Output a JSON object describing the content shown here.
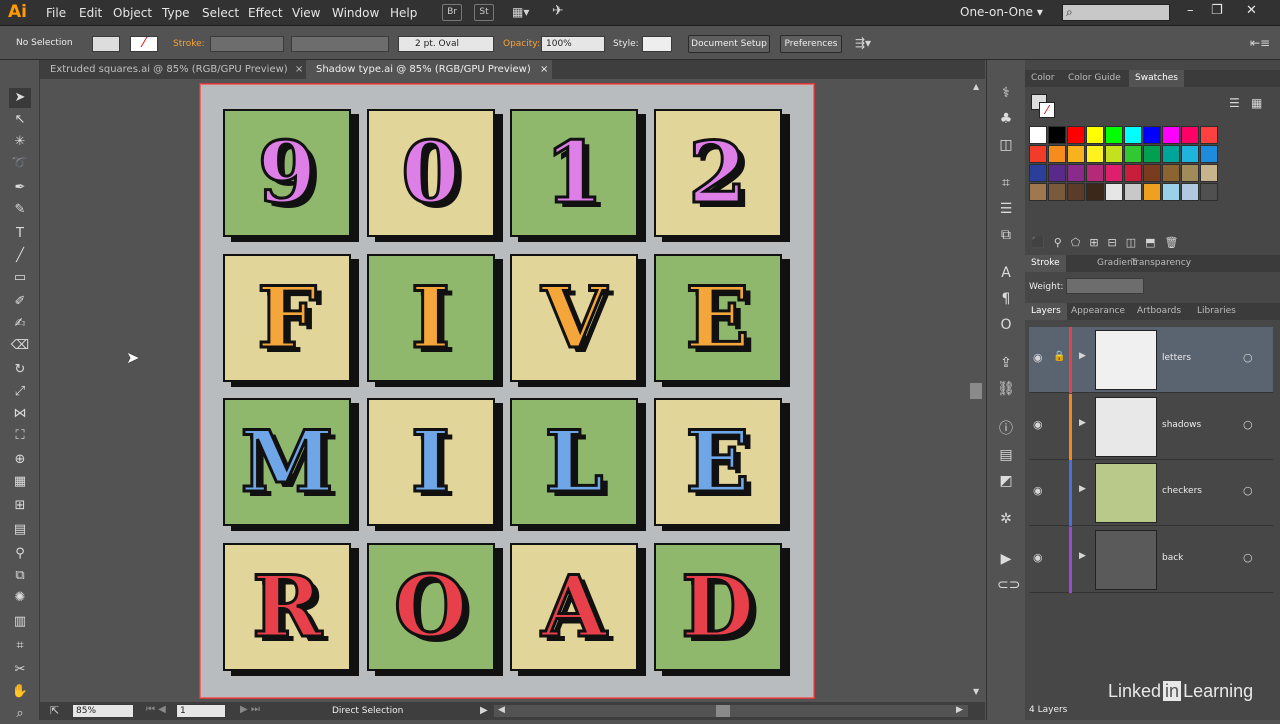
{
  "app": {
    "logo": "Ai"
  },
  "menu": [
    "File",
    "Edit",
    "Object",
    "Type",
    "Select",
    "Effect",
    "View",
    "Window",
    "Help"
  ],
  "menubar_buttons": {
    "br": "Br",
    "st": "St"
  },
  "workspace": {
    "label": "One-on-One",
    "arrow": "▾"
  },
  "control": {
    "selection": "No Selection",
    "stroke_label": "Stroke:",
    "brush": "2 pt. Oval",
    "opacity_label": "Opacity:",
    "opacity_value": "100%",
    "style_label": "Style:",
    "doc_setup": "Document Setup",
    "preferences": "Preferences"
  },
  "tabs": [
    {
      "label": "Extruded squares.ai @ 85% (RGB/GPU Preview)",
      "close": "×"
    },
    {
      "label": "Shadow type.ai @ 85% (RGB/GPU Preview)",
      "close": "×"
    }
  ],
  "tiles": [
    {
      "ch": "9",
      "bg": "#8fb86d",
      "fill": "#de7fe8"
    },
    {
      "ch": "0",
      "bg": "#e2d59a",
      "fill": "#de7fe8"
    },
    {
      "ch": "1",
      "bg": "#8fb86d",
      "fill": "#de7fe8"
    },
    {
      "ch": "2",
      "bg": "#e2d59a",
      "fill": "#de7fe8"
    },
    {
      "ch": "F",
      "bg": "#e2d59a",
      "fill": "#f4a63a"
    },
    {
      "ch": "I",
      "bg": "#8fb86d",
      "fill": "#f4a63a"
    },
    {
      "ch": "V",
      "bg": "#e2d59a",
      "fill": "#f4a63a"
    },
    {
      "ch": "E",
      "bg": "#8fb86d",
      "fill": "#f4a63a"
    },
    {
      "ch": "M",
      "bg": "#8fb86d",
      "fill": "#6fa6e8"
    },
    {
      "ch": "I",
      "bg": "#e2d59a",
      "fill": "#6fa6e8"
    },
    {
      "ch": "L",
      "bg": "#8fb86d",
      "fill": "#6fa6e8"
    },
    {
      "ch": "E",
      "bg": "#e2d59a",
      "fill": "#6fa6e8"
    },
    {
      "ch": "R",
      "bg": "#e2d59a",
      "fill": "#e8404a"
    },
    {
      "ch": "O",
      "bg": "#8fb86d",
      "fill": "#e8404a"
    },
    {
      "ch": "A",
      "bg": "#e2d59a",
      "fill": "#e8404a"
    },
    {
      "ch": "D",
      "bg": "#8fb86d",
      "fill": "#e8404a"
    }
  ],
  "panels": {
    "color_tabs": [
      "Color",
      "Color Guide",
      "Swatches"
    ],
    "stroke_tabs": [
      "Stroke",
      "Gradient",
      "Transparency"
    ],
    "weight_label": "Weight:",
    "layers_tabs": [
      "Layers",
      "Appearance",
      "Artboards",
      "Libraries"
    ],
    "layers": [
      {
        "name": "letters",
        "color": "#e0434b"
      },
      {
        "name": "shadows",
        "color": "#f08a1e"
      },
      {
        "name": "checkers",
        "color": "#4a6fe0"
      },
      {
        "name": "back",
        "color": "#9b4ad2"
      }
    ],
    "layers_count": "4 Layers"
  },
  "status": {
    "zoom": "85%",
    "artboard_num": "1",
    "tool": "Direct Selection"
  },
  "swatches": [
    "#ffffff",
    "#000000",
    "#ff0000",
    "#ffff00",
    "#00ff00",
    "#00ffff",
    "#0000ff",
    "#ff00ff",
    "#ff0066",
    "#ff4040",
    "#f03c28",
    "#f78c1e",
    "#f7b21e",
    "#fff21e",
    "#c4e11e",
    "#32c832",
    "#00a050",
    "#00a59a",
    "#1eb4dc",
    "#1e8cdc",
    "#2a3e9a",
    "#5a2a8a",
    "#8a2a8a",
    "#b42a78",
    "#e01e6e",
    "#c81e3c",
    "#7a3c1e",
    "#8c6432",
    "#a08c5a",
    "#c8b48c",
    "#a07850",
    "#7a5a3c",
    "#5a3c28",
    "#3c2818",
    "#e6e6e6",
    "#c8c8c8",
    "#f0a020",
    "#9ad0e8",
    "#b0c8e0",
    "#505050"
  ],
  "watermark": "Linked in Learning"
}
